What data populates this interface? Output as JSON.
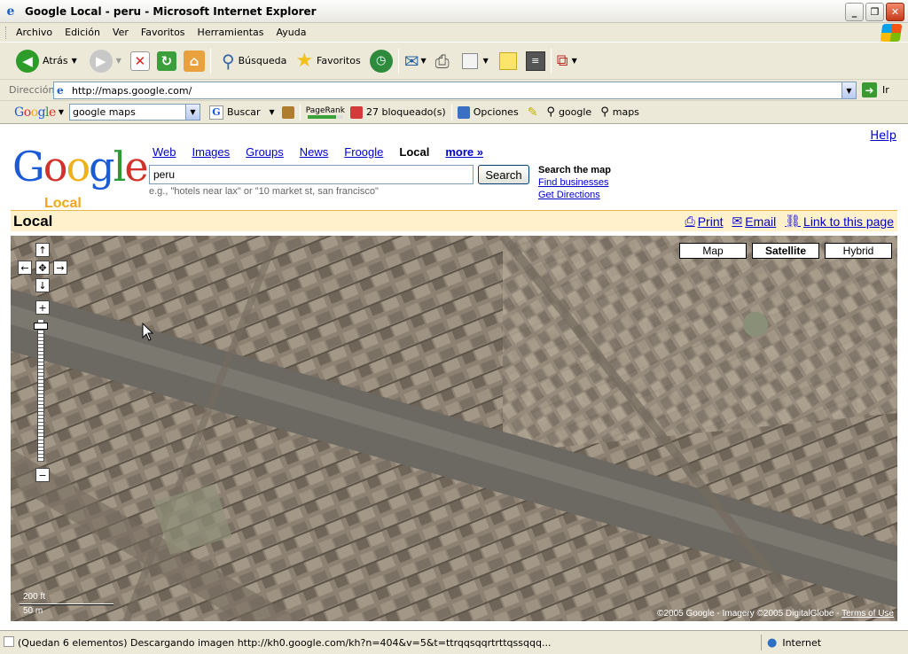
{
  "window": {
    "title": "Google Local - peru - Microsoft Internet Explorer"
  },
  "menu": [
    "Archivo",
    "Edición",
    "Ver",
    "Favoritos",
    "Herramientas",
    "Ayuda"
  ],
  "toolbar": {
    "back": "Atrás",
    "search": "Búsqueda",
    "favorites": "Favoritos"
  },
  "address": {
    "label": "Dirección",
    "url": "http://maps.google.com/",
    "go": "Ir"
  },
  "google_toolbar": {
    "logo": "Google",
    "query": "google maps",
    "search": "Buscar",
    "pagerank": "PageRank",
    "blocked": "27 bloqueado(s)",
    "options": "Opciones",
    "link1": "google",
    "link2": "maps"
  },
  "page": {
    "help": "Help",
    "logo_sub": "Local",
    "tabs": [
      "Web",
      "Images",
      "Groups",
      "News",
      "Froogle",
      "Local",
      "more »"
    ],
    "search_value": "peru",
    "search_button": "Search",
    "hint": "e.g., \"hotels near lax\" or \"10 market st, san francisco\"",
    "right_title": "Search the map",
    "right_links": [
      "Find businesses",
      "Get Directions"
    ],
    "section_title": "Local",
    "actions": {
      "print": "Print",
      "email": "Email",
      "link": "Link to this page"
    }
  },
  "map": {
    "types": [
      "Map",
      "Satellite",
      "Hybrid"
    ],
    "selected_type": "Satellite",
    "scale_ft": "200 ft",
    "scale_m": "50 m",
    "copyright": "©2005 Google - Imagery ©2005 DigitalGlobe - ",
    "terms": "Terms of Use"
  },
  "status": {
    "message": "(Quedan 6 elementos) Descargando imagen http://kh0.google.com/kh?n=404&v=5&t=ttrqqsqqrtrttqssqqq...",
    "zone": "Internet"
  },
  "colors": {
    "link": "#0000cc",
    "local_bar": "#fff1cc",
    "xp_chrome": "#ece9d8"
  }
}
